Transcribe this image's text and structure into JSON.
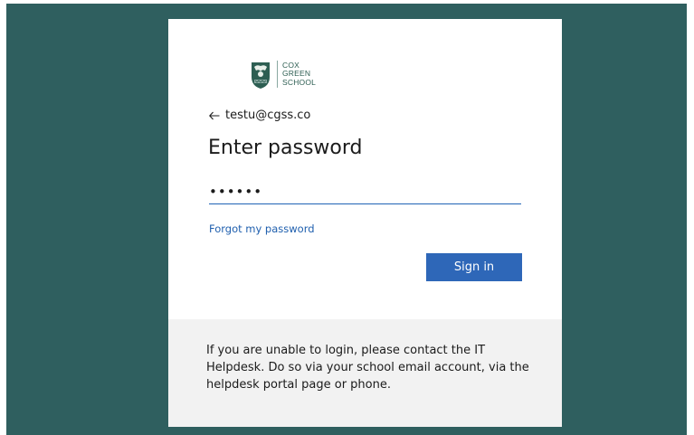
{
  "branding": {
    "crest_icon": "school-crest-icon",
    "name_lines": [
      "COX",
      "GREEN",
      "SCHOOL"
    ],
    "color": "#2d5e52"
  },
  "identity": {
    "back_icon": "arrow-left-icon",
    "email": "testu@cgss.co"
  },
  "form": {
    "title": "Enter password",
    "password_value": "••••••",
    "forgot_link": "Forgot my password",
    "signin_label": "Sign in"
  },
  "footer": {
    "message": "If you are unable to login, please contact the IT Helpdesk. Do so via your school email account, via the helpdesk portal page or phone."
  },
  "colors": {
    "background": "#2f5f5f",
    "accent": "#2e67b8",
    "link": "#1f5fae",
    "footer_bg": "#f2f2f2"
  }
}
